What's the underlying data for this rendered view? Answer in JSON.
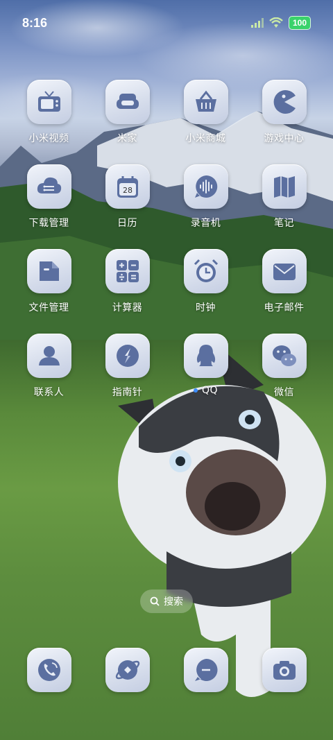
{
  "status_bar": {
    "time": "8:16",
    "battery": "100"
  },
  "apps": [
    {
      "label": "小米视频",
      "icon": "tv-icon"
    },
    {
      "label": "米家",
      "icon": "sofa-icon"
    },
    {
      "label": "小米商城",
      "icon": "shopping-basket-icon"
    },
    {
      "label": "游戏中心",
      "icon": "pacman-icon"
    },
    {
      "label": "下载管理",
      "icon": "cloud-download-icon"
    },
    {
      "label": "日历",
      "icon": "calendar-icon",
      "badge_text": "28"
    },
    {
      "label": "录音机",
      "icon": "sound-wave-icon"
    },
    {
      "label": "笔记",
      "icon": "notebook-icon"
    },
    {
      "label": "文件管理",
      "icon": "folder-icon"
    },
    {
      "label": "计算器",
      "icon": "calculator-icon"
    },
    {
      "label": "时钟",
      "icon": "alarm-clock-icon"
    },
    {
      "label": "电子邮件",
      "icon": "mail-icon"
    },
    {
      "label": "联系人",
      "icon": "contact-person-icon"
    },
    {
      "label": "指南针",
      "icon": "compass-icon"
    },
    {
      "label": "QQ",
      "icon": "penguin-icon",
      "new_indicator": true
    },
    {
      "label": "微信",
      "icon": "wechat-icon"
    }
  ],
  "search": {
    "label": "搜索"
  },
  "dock": [
    {
      "icon": "phone-icon"
    },
    {
      "icon": "browser-planet-icon"
    },
    {
      "icon": "message-icon"
    },
    {
      "icon": "camera-icon"
    }
  ],
  "colors": {
    "icon_glyph": "#5b6fa0",
    "battery": "#39d26b",
    "new_dot": "#3b8cff"
  }
}
